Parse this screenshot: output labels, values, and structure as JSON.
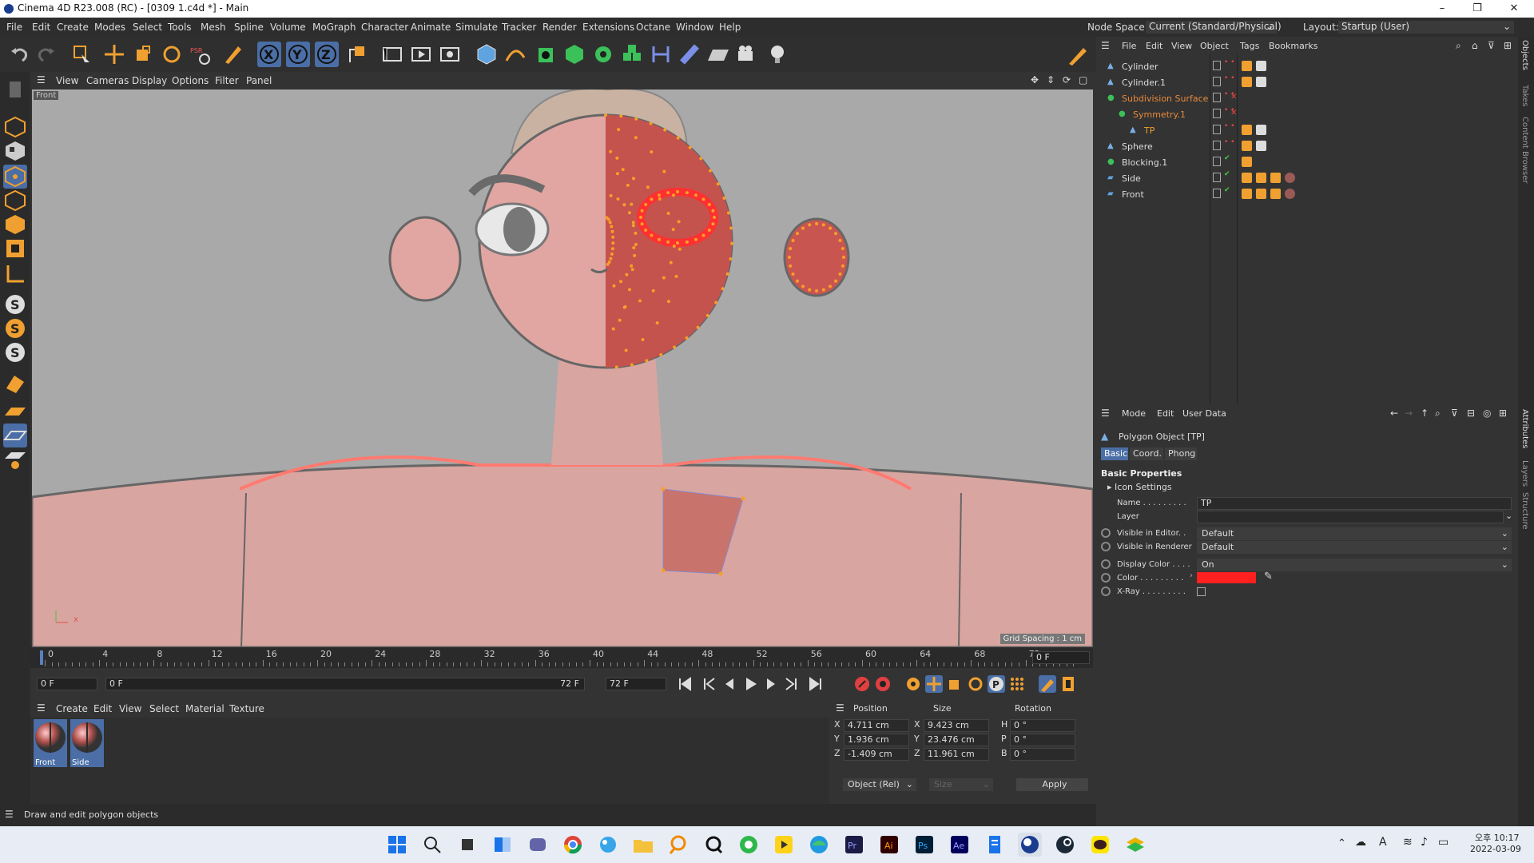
{
  "window": {
    "title": "Cinema 4D R23.008 (RC) - [0309 1.c4d *] - Main",
    "controls": [
      "–",
      "❐",
      "✕"
    ]
  },
  "menubar": {
    "items": [
      "File",
      "Edit",
      "Create",
      "Modes",
      "Select",
      "Tools",
      "Mesh",
      "Spline",
      "Volume",
      "MoGraph",
      "Character",
      "Animate",
      "Simulate",
      "Tracker",
      "Render",
      "Extensions",
      "Octane",
      "Window",
      "Help"
    ],
    "node_space_label": "Node Space:",
    "node_space_value": "Current (Standard/Physical)",
    "layout_label": "Layout:",
    "layout_value": "Startup (User)"
  },
  "toolbar": {
    "axis_x": "X",
    "axis_y": "Y",
    "axis_z": "Z"
  },
  "viewport": {
    "menu": [
      "View",
      "Cameras",
      "Display",
      "Options",
      "Filter",
      "Panel"
    ],
    "camera_label": "Front",
    "grid_spacing": "Grid Spacing : 1 cm",
    "axis_x": "x",
    "axis_y": "y"
  },
  "timeline": {
    "ticks": [
      "0",
      "4",
      "8",
      "12",
      "16",
      "20",
      "24",
      "28",
      "32",
      "36",
      "40",
      "44",
      "48",
      "52",
      "56",
      "60",
      "64",
      "68",
      "72"
    ],
    "frame_field": "0 F"
  },
  "transport": {
    "start": "0 F",
    "range_start": "0 F",
    "range_end": "72 F",
    "end": "72 F"
  },
  "material": {
    "menu": [
      "Create",
      "Edit",
      "View",
      "Select",
      "Material",
      "Texture"
    ],
    "items": [
      {
        "name": "Front"
      },
      {
        "name": "Side"
      }
    ]
  },
  "coords": {
    "headers": [
      "Position",
      "Size",
      "Rotation"
    ],
    "rows": [
      {
        "axis": "X",
        "pos": "4.711 cm",
        "size_axis": "X",
        "size": "9.423 cm",
        "rot_axis": "H",
        "rot": "0 °"
      },
      {
        "axis": "Y",
        "pos": "1.936 cm",
        "size_axis": "Y",
        "size": "23.476 cm",
        "rot_axis": "P",
        "rot": "0 °"
      },
      {
        "axis": "Z",
        "pos": "-1.409 cm",
        "size_axis": "Z",
        "size": "11.961 cm",
        "rot_axis": "B",
        "rot": "0 °"
      }
    ],
    "mode": "Object (Rel)",
    "size_mode": "Size",
    "apply": "Apply"
  },
  "status": {
    "text": "Draw and edit polygon objects"
  },
  "objects": {
    "menu": [
      "File",
      "Edit",
      "View",
      "Object",
      "Tags",
      "Bookmarks"
    ],
    "items": [
      {
        "name": "Cylinder",
        "color": "#dddddd"
      },
      {
        "name": "Cylinder.1",
        "color": "#dddddd"
      },
      {
        "name": "Subdivision Surface",
        "color": "#e8893a"
      },
      {
        "name": "Symmetry.1",
        "color": "#e8893a"
      },
      {
        "name": "TP",
        "color": "#f0a030"
      },
      {
        "name": "Sphere",
        "color": "#dddddd"
      },
      {
        "name": "Blocking.1",
        "color": "#dddddd"
      },
      {
        "name": "Side",
        "color": "#dddddd"
      },
      {
        "name": "Front",
        "color": "#dddddd"
      }
    ],
    "side_tabs": [
      "Objects",
      "Takes",
      "Content Browser"
    ]
  },
  "attributes": {
    "menu": [
      "Mode",
      "Edit",
      "User Data"
    ],
    "object_title": "Polygon Object [TP]",
    "tabs": [
      "Basic",
      "Coord.",
      "Phong"
    ],
    "section": "Basic Properties",
    "icon_settings": "Icon Settings",
    "fields": [
      {
        "label": "Name . . . . . . . . .",
        "value": "TP"
      },
      {
        "label": "Layer",
        "value": ""
      },
      {
        "label": "Visible in Editor. .",
        "value": "Default"
      },
      {
        "label": "Visible in Renderer",
        "value": "Default"
      },
      {
        "label": "Display Color . . . .",
        "value": "On"
      },
      {
        "label": "Color . . . . . . . . .",
        "value": ""
      },
      {
        "label": "X-Ray . . . . . . . . .",
        "value": ""
      }
    ],
    "color_value": "#ff2020",
    "side_tabs": [
      "Attributes",
      "Layers",
      "Structure"
    ]
  },
  "taskbar": {
    "time": "오후 10:17",
    "date": "2022-03-09",
    "ime": "A"
  }
}
